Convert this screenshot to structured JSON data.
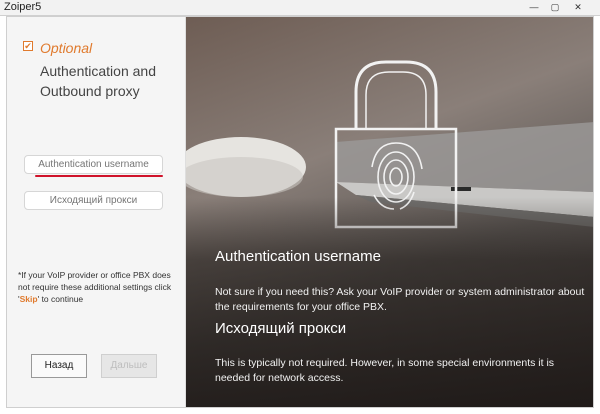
{
  "window": {
    "title": "Zoiper5",
    "minimize": "—",
    "maximize": "▢",
    "close": "✕"
  },
  "left_panel": {
    "check_mark": "✔",
    "optional_label": "Optional",
    "heading": "Authentication and Outbound proxy",
    "auth_username_placeholder": "Authentication username",
    "outbound_proxy_placeholder": "Исходящий прокси",
    "note_before": "*If your VoIP provider or office PBX does not require these additional settings click '",
    "note_skip": "Skip",
    "note_after": "' to continue",
    "back_label": "Назад",
    "next_label": "Дальше"
  },
  "info_panel": {
    "auth_title": "Authentication username",
    "auth_text": "Not sure if you need this? Ask your VoIP provider or system administrator about the requirements for your office PBX.",
    "proxy_title": "Исходящий прокси",
    "proxy_text": "This is typically not required. However, in some special environments it is needed for network access."
  },
  "colors": {
    "accent": "#e07a2d",
    "underline": "#d0132b"
  }
}
